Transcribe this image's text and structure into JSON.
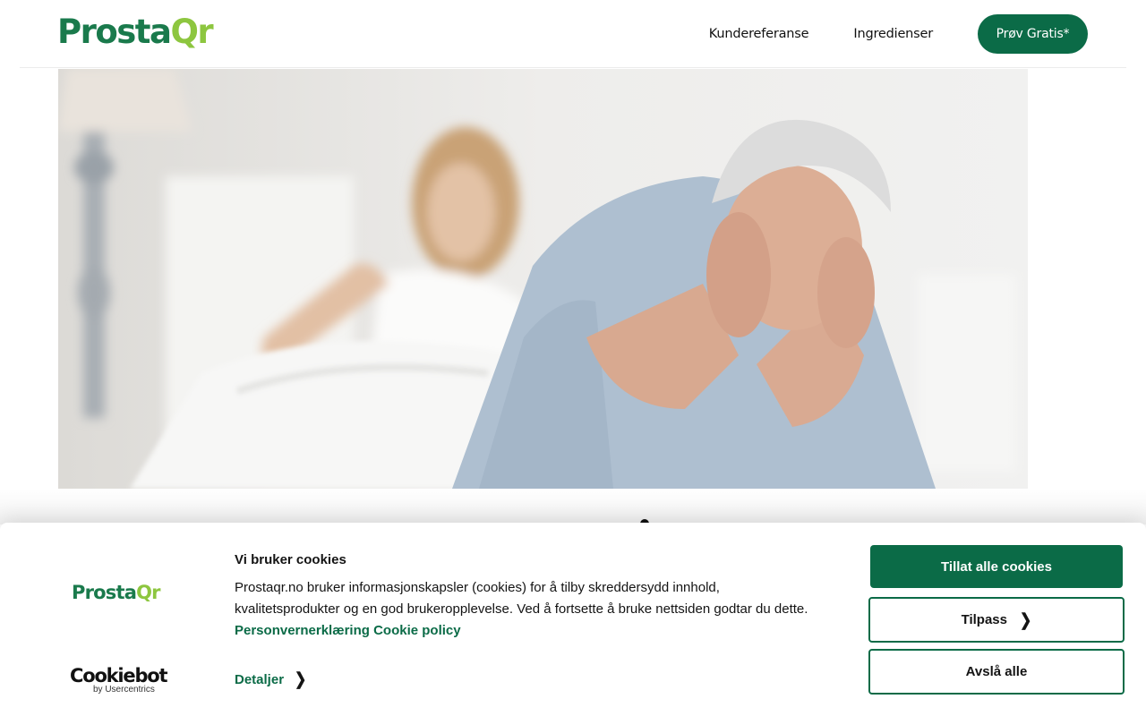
{
  "header": {
    "logo_part1": "Prosta",
    "logo_part2": "Qr",
    "nav": [
      {
        "label": "Kundereferanse"
      },
      {
        "label": "Ingredienser"
      }
    ],
    "cta_label": "Prøv Gratis*"
  },
  "hero": {
    "image_icon": "hero-photo-couple-in-bed"
  },
  "cookie_banner": {
    "logo_part1": "Prosta",
    "logo_part2": "Qr",
    "title": "Vi bruker cookies",
    "text": "Prostaqr.no bruker informasjonskapsler (cookies) for å tilby skreddersydd innhold, kvalitetsprodukter og en god brukeropplevelse. Ved å fortsette å bruke nettsiden godtar du dette.",
    "links": [
      "Personvernerklæring",
      "Cookie policy"
    ],
    "details_label": "Detaljer",
    "buttons": {
      "allow_all": "Tillat alle cookies",
      "customize": "Tilpass",
      "deny_all": "Avslå alle"
    },
    "provider": {
      "name": "Cookiebot",
      "sub": "by Usercentrics"
    }
  },
  "colors": {
    "brand_green": "#0b6b47",
    "logo_dark_green": "#1a7a4c",
    "logo_light_green": "#8dc63f"
  }
}
